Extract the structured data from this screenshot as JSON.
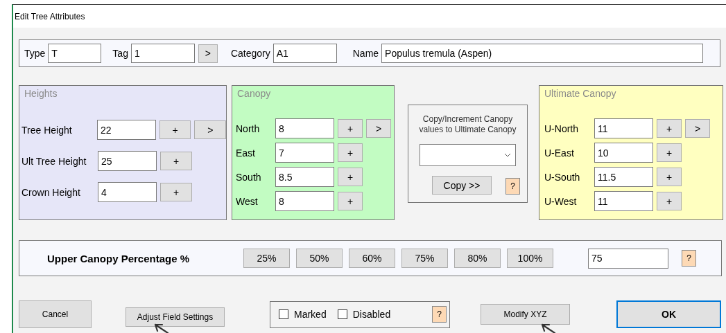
{
  "window": {
    "title": "Edit Tree Attributes"
  },
  "identity": [
    {
      "label": "Type",
      "value": "T"
    },
    {
      "label": "Tag",
      "value": "1",
      "button": ">"
    },
    {
      "label": "Category",
      "value": "A1"
    },
    {
      "label": "Name",
      "value": "Populus tremula (Aspen)"
    }
  ],
  "heights": {
    "title": "Heights",
    "rows": [
      {
        "label": "Tree Height",
        "value": "22",
        "buttons": [
          "+",
          ">"
        ]
      },
      {
        "label": "Ult Tree Height",
        "value": "25",
        "buttons": [
          "+"
        ]
      },
      {
        "label": "Crown Height",
        "value": "4",
        "buttons": [
          "+"
        ]
      }
    ]
  },
  "canopy": {
    "title": "Canopy",
    "rows": [
      {
        "label": "North",
        "value": "8",
        "buttons": [
          "+",
          ">"
        ]
      },
      {
        "label": "East",
        "value": "7",
        "buttons": [
          "+"
        ]
      },
      {
        "label": "South",
        "value": "8.5",
        "buttons": [
          "+"
        ]
      },
      {
        "label": "West",
        "value": "8",
        "buttons": [
          "+"
        ]
      }
    ]
  },
  "copy_panel": {
    "caption": "Copy/Increment Canopy values to Ultimate Canopy",
    "button": "Copy >>",
    "help": "?"
  },
  "ultimate_canopy": {
    "title": "Ultimate Canopy",
    "rows": [
      {
        "label": "U-North",
        "value": "11",
        "buttons": [
          "+",
          ">"
        ]
      },
      {
        "label": "U-East",
        "value": "10",
        "buttons": [
          "+"
        ]
      },
      {
        "label": "U-South",
        "value": "11.5",
        "buttons": [
          "+"
        ]
      },
      {
        "label": "U-West",
        "value": "11",
        "buttons": [
          "+"
        ]
      }
    ]
  },
  "upper_canopy": {
    "label": "Upper Canopy Percentage %",
    "presets": [
      "25%",
      "50%",
      "60%",
      "75%",
      "80%",
      "100%"
    ],
    "value": "75",
    "help": "?"
  },
  "footer": {
    "cancel": "Cancel",
    "adjust": "Adjust Field Settings",
    "checkboxes": [
      {
        "label": "Marked",
        "checked": false
      },
      {
        "label": "Disabled",
        "checked": false
      }
    ],
    "help": "?",
    "modify": "Modify XYZ",
    "ok": "OK"
  }
}
